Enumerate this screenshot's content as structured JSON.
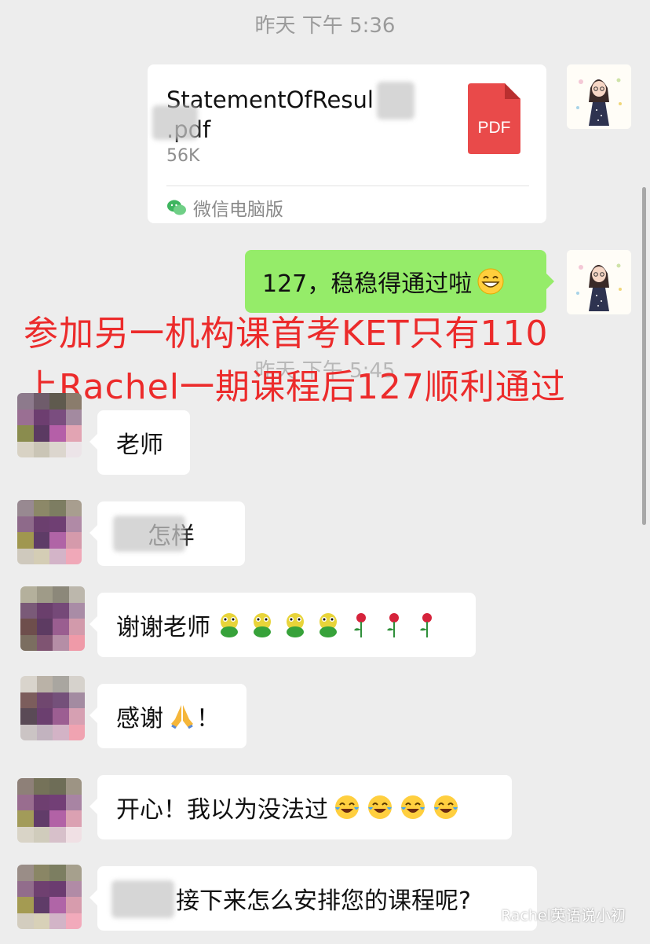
{
  "timestamps": {
    "first": "昨天 下午 5:36",
    "second": "昨天 下午 5:45"
  },
  "file_message": {
    "file_name": "StatementOfResul　　　.pdf",
    "file_size": "56K",
    "icon_label": "PDF",
    "source": "微信电脑版"
  },
  "self_message": {
    "text": "127，稳稳得通过啦"
  },
  "overlay": {
    "line1": "参加另一机构课首考KET只有110",
    "line2": "上Rachel一期课程后127顺利通过",
    "color": "#ec2b2b"
  },
  "messages": [
    {
      "text": "老师"
    },
    {
      "text": "怎样"
    },
    {
      "text": "谢谢老师"
    },
    {
      "text": "感谢",
      "suffix": "！"
    },
    {
      "text": "开心！我以为没法过"
    },
    {
      "text": "接下来怎么安排您的课程呢?"
    }
  ],
  "watermark": {
    "text": "Rachel英语说小初"
  },
  "colors": {
    "bubble_self": "#95ec69",
    "bubble_other": "#ffffff",
    "background": "#ededed"
  }
}
